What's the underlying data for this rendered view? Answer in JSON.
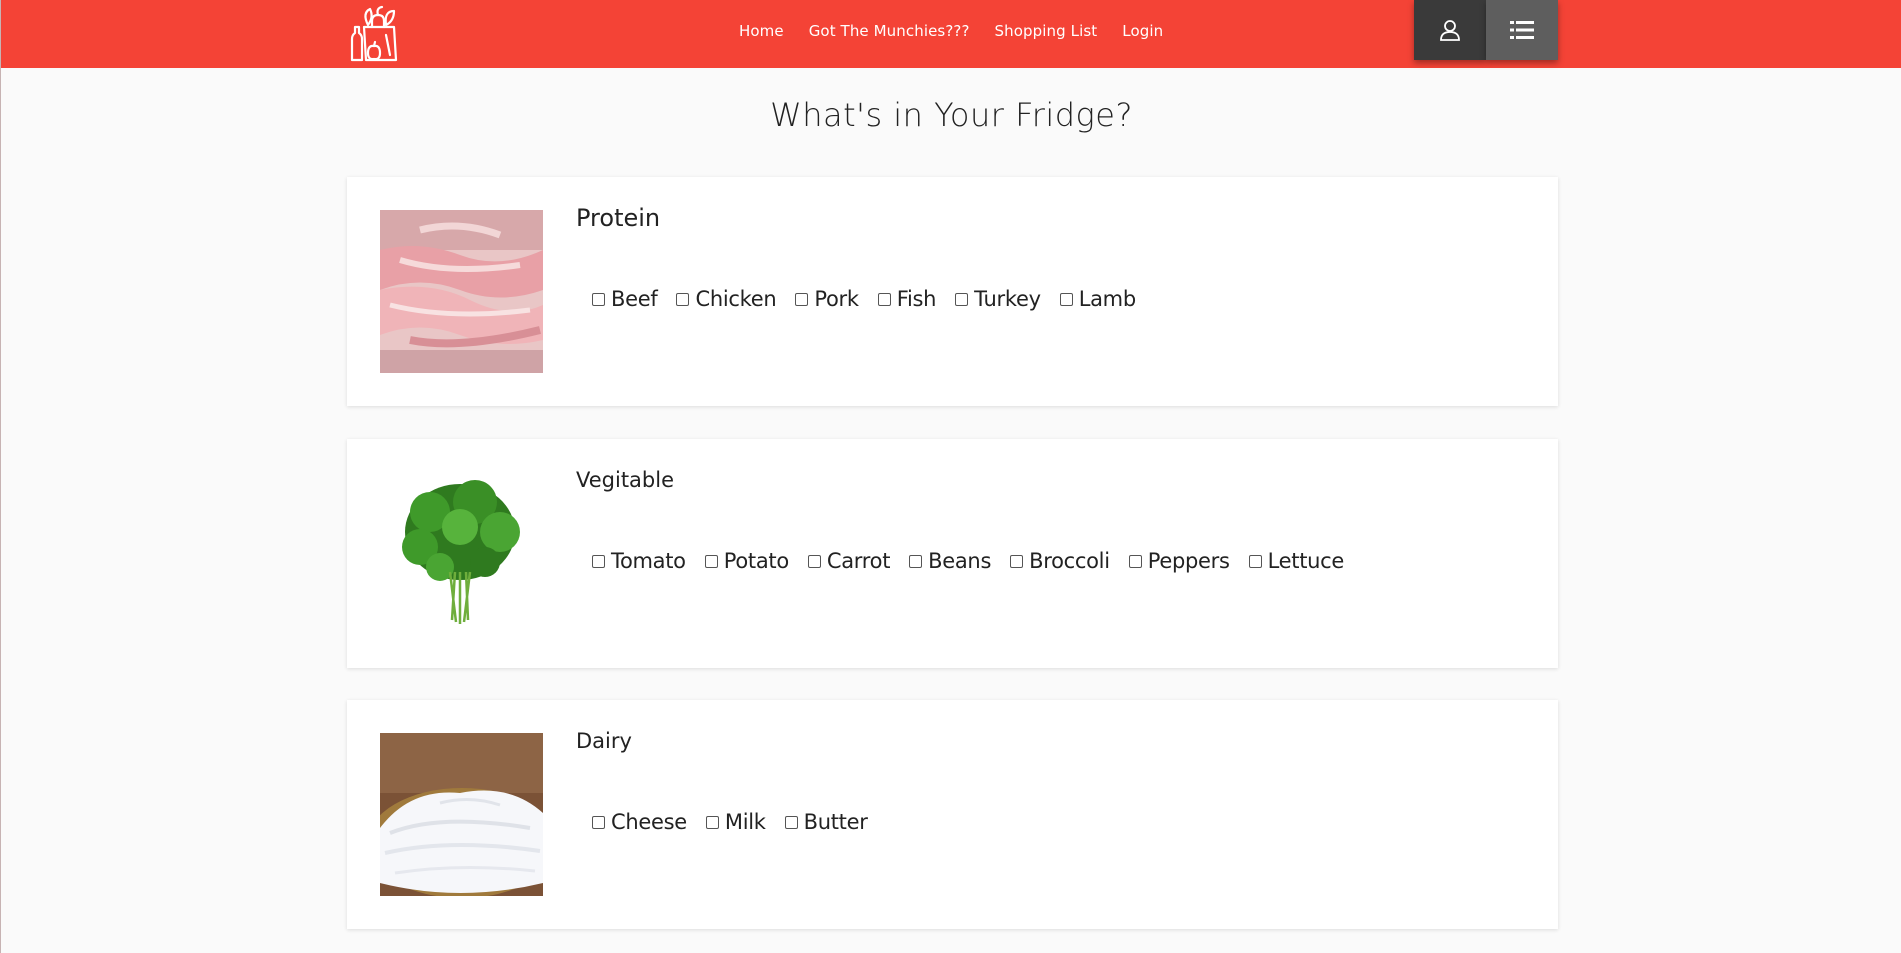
{
  "nav": {
    "links": [
      "Home",
      "Got The Munchies???",
      "Shopping List",
      "Login"
    ],
    "brand_color": "#f44336",
    "icons": {
      "user": "user-icon",
      "list": "list-icon",
      "logo": "grocery-bag-logo-icon"
    }
  },
  "page_title": "What's in Your Fridge?",
  "categories": [
    {
      "title": "Protein",
      "image": "raw-chicken-strips-image",
      "options": [
        "Beef",
        "Chicken",
        "Pork",
        "Fish",
        "Turkey",
        "Lamb"
      ]
    },
    {
      "title": "Vegitable",
      "image": "parsley-bunch-image",
      "options": [
        "Tomato",
        "Potato",
        "Carrot",
        "Beans",
        "Broccoli",
        "Peppers",
        "Lettuce"
      ]
    },
    {
      "title": "Dairy",
      "image": "sour-cream-bowl-image",
      "options": [
        "Cheese",
        "Milk",
        "Butter"
      ]
    }
  ]
}
